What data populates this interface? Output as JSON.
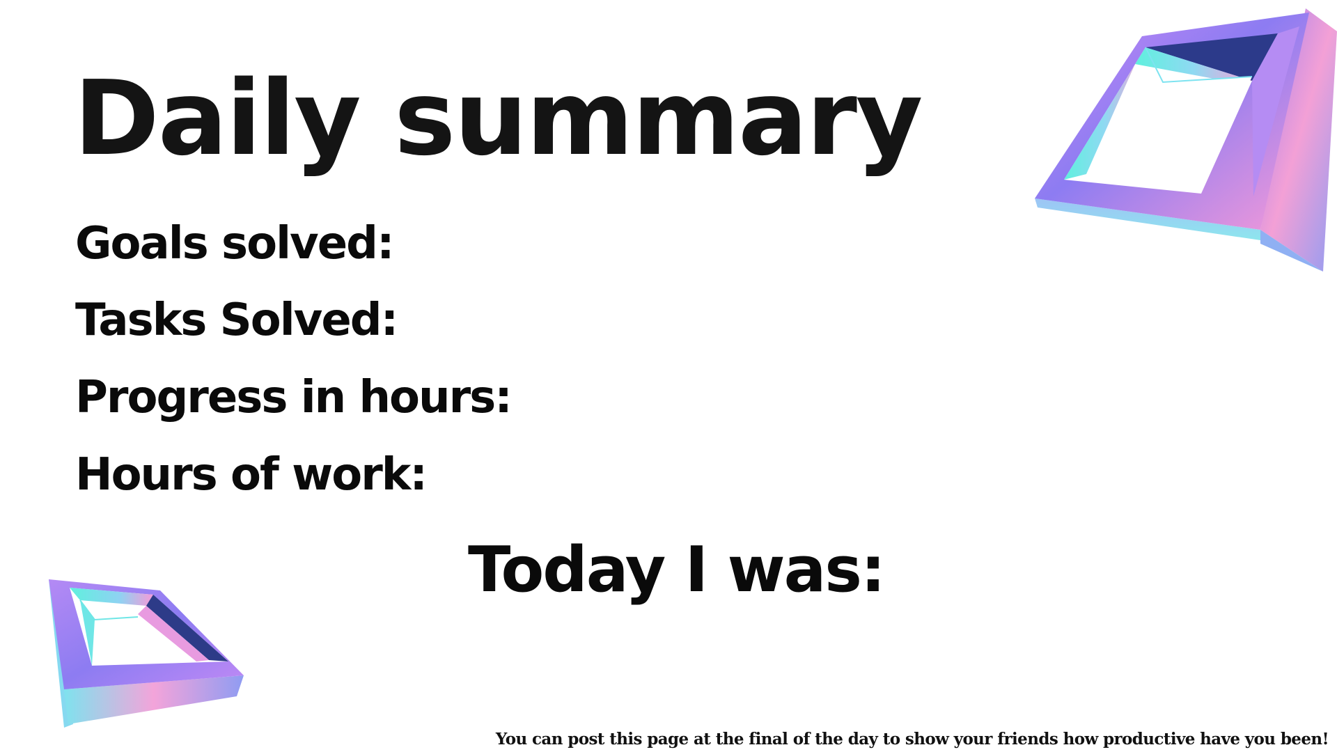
{
  "title": "Daily summary",
  "stats": [
    {
      "label": "Goals solved:"
    },
    {
      "label": "Tasks Solved:"
    },
    {
      "label": "Progress in hours:"
    },
    {
      "label": "Hours of work:"
    }
  ],
  "today_label": "Today I was:",
  "footer_note": "You can post this page at the final of the day to show your friends how productive have you been!",
  "decorations": [
    {
      "icon": "holographic-square-frame-icon"
    },
    {
      "icon": "holographic-square-frame-icon"
    }
  ],
  "colors": {
    "background": "#ffffff",
    "text": "#0a0a0a",
    "holo_purple": "#9b6cf0",
    "holo_pink": "#f59ad8",
    "holo_cyan": "#5ff0de",
    "holo_blue": "#8fa8f5"
  }
}
